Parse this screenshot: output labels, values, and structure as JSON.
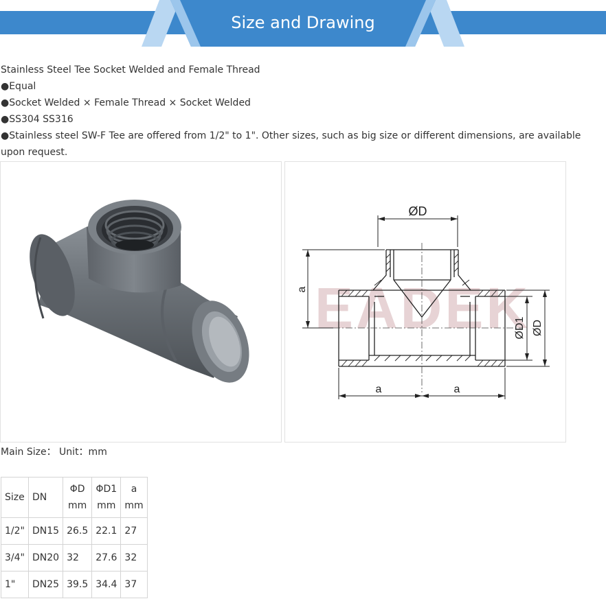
{
  "banner": {
    "title": "Size and Drawing"
  },
  "intro": {
    "lines": [
      "Stainless Steel Tee Socket Welded and Female Thread",
      "●Equal",
      "●Socket Welded × Female Thread × Socket Welded",
      "●SS304 SS316",
      "●Stainless steel SW-F Tee are offered from 1/2\" to 1\". Other sizes, such as big size or different dimensions, are available upon request."
    ]
  },
  "drawing": {
    "label_top_d": "ØD",
    "label_a_vertical": "a",
    "label_d1": "ØD1",
    "label_d_side": "ØD",
    "label_a_left": "a",
    "label_a_right": "a",
    "watermark": "EADEK"
  },
  "main_size": {
    "text": "Main Size：  Unit：mm"
  },
  "table": {
    "headers": [
      {
        "line1": "Size",
        "line2": ""
      },
      {
        "line1": "DN",
        "line2": ""
      },
      {
        "line1": "ΦD",
        "line2": "mm"
      },
      {
        "line1": "ΦD1",
        "line2": "mm"
      },
      {
        "line1": "a",
        "line2": "mm"
      }
    ],
    "rows": [
      [
        "1/2\"",
        "DN15",
        "26.5",
        "22.1",
        "27"
      ],
      [
        "3/4\"",
        "DN20",
        "32",
        "27.6",
        "32"
      ],
      [
        "1\"",
        "DN25",
        "39.5",
        "34.4",
        "37"
      ]
    ]
  },
  "colors": {
    "banner_blue": "#3d88cc",
    "banner_light": "#9cc6ec",
    "fitting_gray": "#6e747a"
  }
}
